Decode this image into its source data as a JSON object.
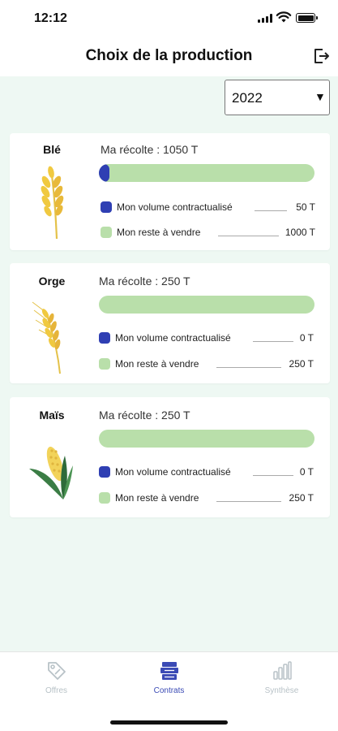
{
  "status_bar": {
    "time": "12:12"
  },
  "header": {
    "title": "Choix de la production"
  },
  "year_select": {
    "value": "2022",
    "arrow": "▼"
  },
  "colors": {
    "contracted": "#2f3fb3",
    "remaining": "#b9dfaa",
    "background": "#eef8f3",
    "tab_active": "#3a4ab5",
    "tab_inactive": "#b8c2c7"
  },
  "crops": [
    {
      "name": "Blé",
      "harvest": "Ma récolte : 1050 T",
      "contracted_label": "Mon volume contractualisé",
      "contracted_value": "50 T",
      "remaining_label": "Mon reste à vendre",
      "remaining_value": "1000 T",
      "contracted_fraction": 0.048,
      "icon": "wheat-icon"
    },
    {
      "name": "Orge",
      "harvest": "Ma récolte : 250 T",
      "contracted_label": "Mon volume contractualisé",
      "contracted_value": "0 T",
      "remaining_label": "Mon reste à vendre",
      "remaining_value": "250 T",
      "contracted_fraction": 0,
      "icon": "barley-icon"
    },
    {
      "name": "Maïs",
      "harvest": "Ma récolte : 250 T",
      "contracted_label": "Mon volume contractualisé",
      "contracted_value": "0 T",
      "remaining_label": "Mon reste à vendre",
      "remaining_value": "250 T",
      "contracted_fraction": 0,
      "icon": "corn-icon"
    }
  ],
  "bottom_nav": [
    {
      "label": "Offres",
      "icon": "tag-icon",
      "active": false
    },
    {
      "label": "Contrats",
      "icon": "documents-icon",
      "active": true
    },
    {
      "label": "Synthèse",
      "icon": "bar-chart-icon",
      "active": false
    }
  ]
}
